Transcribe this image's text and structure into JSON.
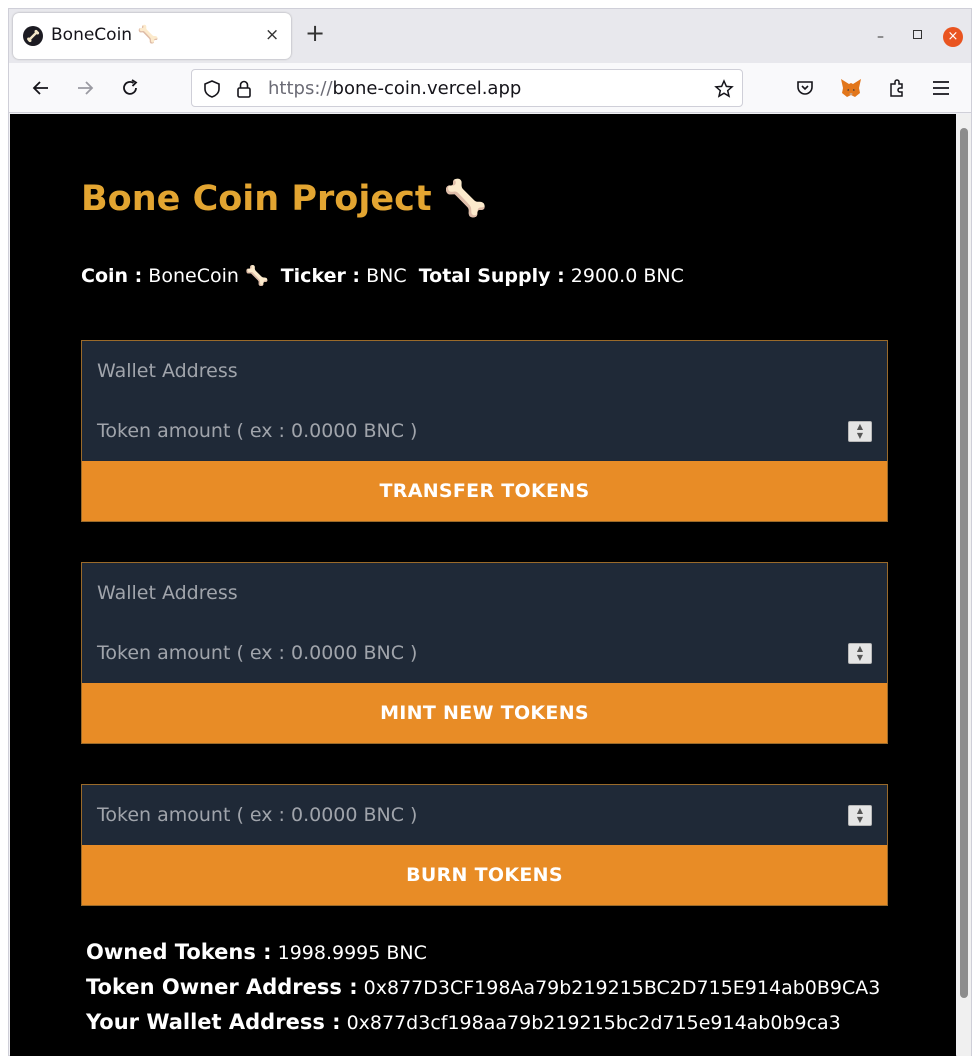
{
  "browser": {
    "tab_title": "BoneCoin 🦴",
    "tab_close": "×",
    "new_tab": "+",
    "url_scheme": "https://",
    "url_host": "bone-coin.vercel.app",
    "window_minimize": "–",
    "window_close": "×"
  },
  "page": {
    "title": "Bone Coin Project 🦴",
    "coin_label": "Coin :",
    "coin_value": "BoneCoin 🦴",
    "ticker_label": "Ticker :",
    "ticker_value": "BNC",
    "supply_label": "Total Supply :",
    "supply_value": "2900.0 BNC"
  },
  "transfer": {
    "wallet_placeholder": "Wallet Address",
    "amount_placeholder": "Token amount ( ex : 0.0000 BNC )",
    "button_label": "TRANSFER TOKENS"
  },
  "mint": {
    "wallet_placeholder": "Wallet Address",
    "amount_placeholder": "Token amount ( ex : 0.0000 BNC )",
    "button_label": "MINT NEW TOKENS"
  },
  "burn": {
    "amount_placeholder": "Token amount ( ex : 0.0000 BNC )",
    "button_label": "BURN TOKENS"
  },
  "stats": {
    "owned_label": "Owned Tokens :",
    "owned_value": "1998.9995 BNC",
    "owner_label": "Token Owner Address :",
    "owner_value": "0x877D3CF198Aa79b219215BC2D715E914ab0B9CA3",
    "wallet_label": "Your Wallet Address :",
    "wallet_value": "0x877d3cf198aa79b219215bc2d715e914ab0b9ca3"
  },
  "colors": {
    "accent": "#e88c26",
    "title": "#e3a531",
    "field_bg": "#1f2937",
    "page_bg": "#000000"
  }
}
